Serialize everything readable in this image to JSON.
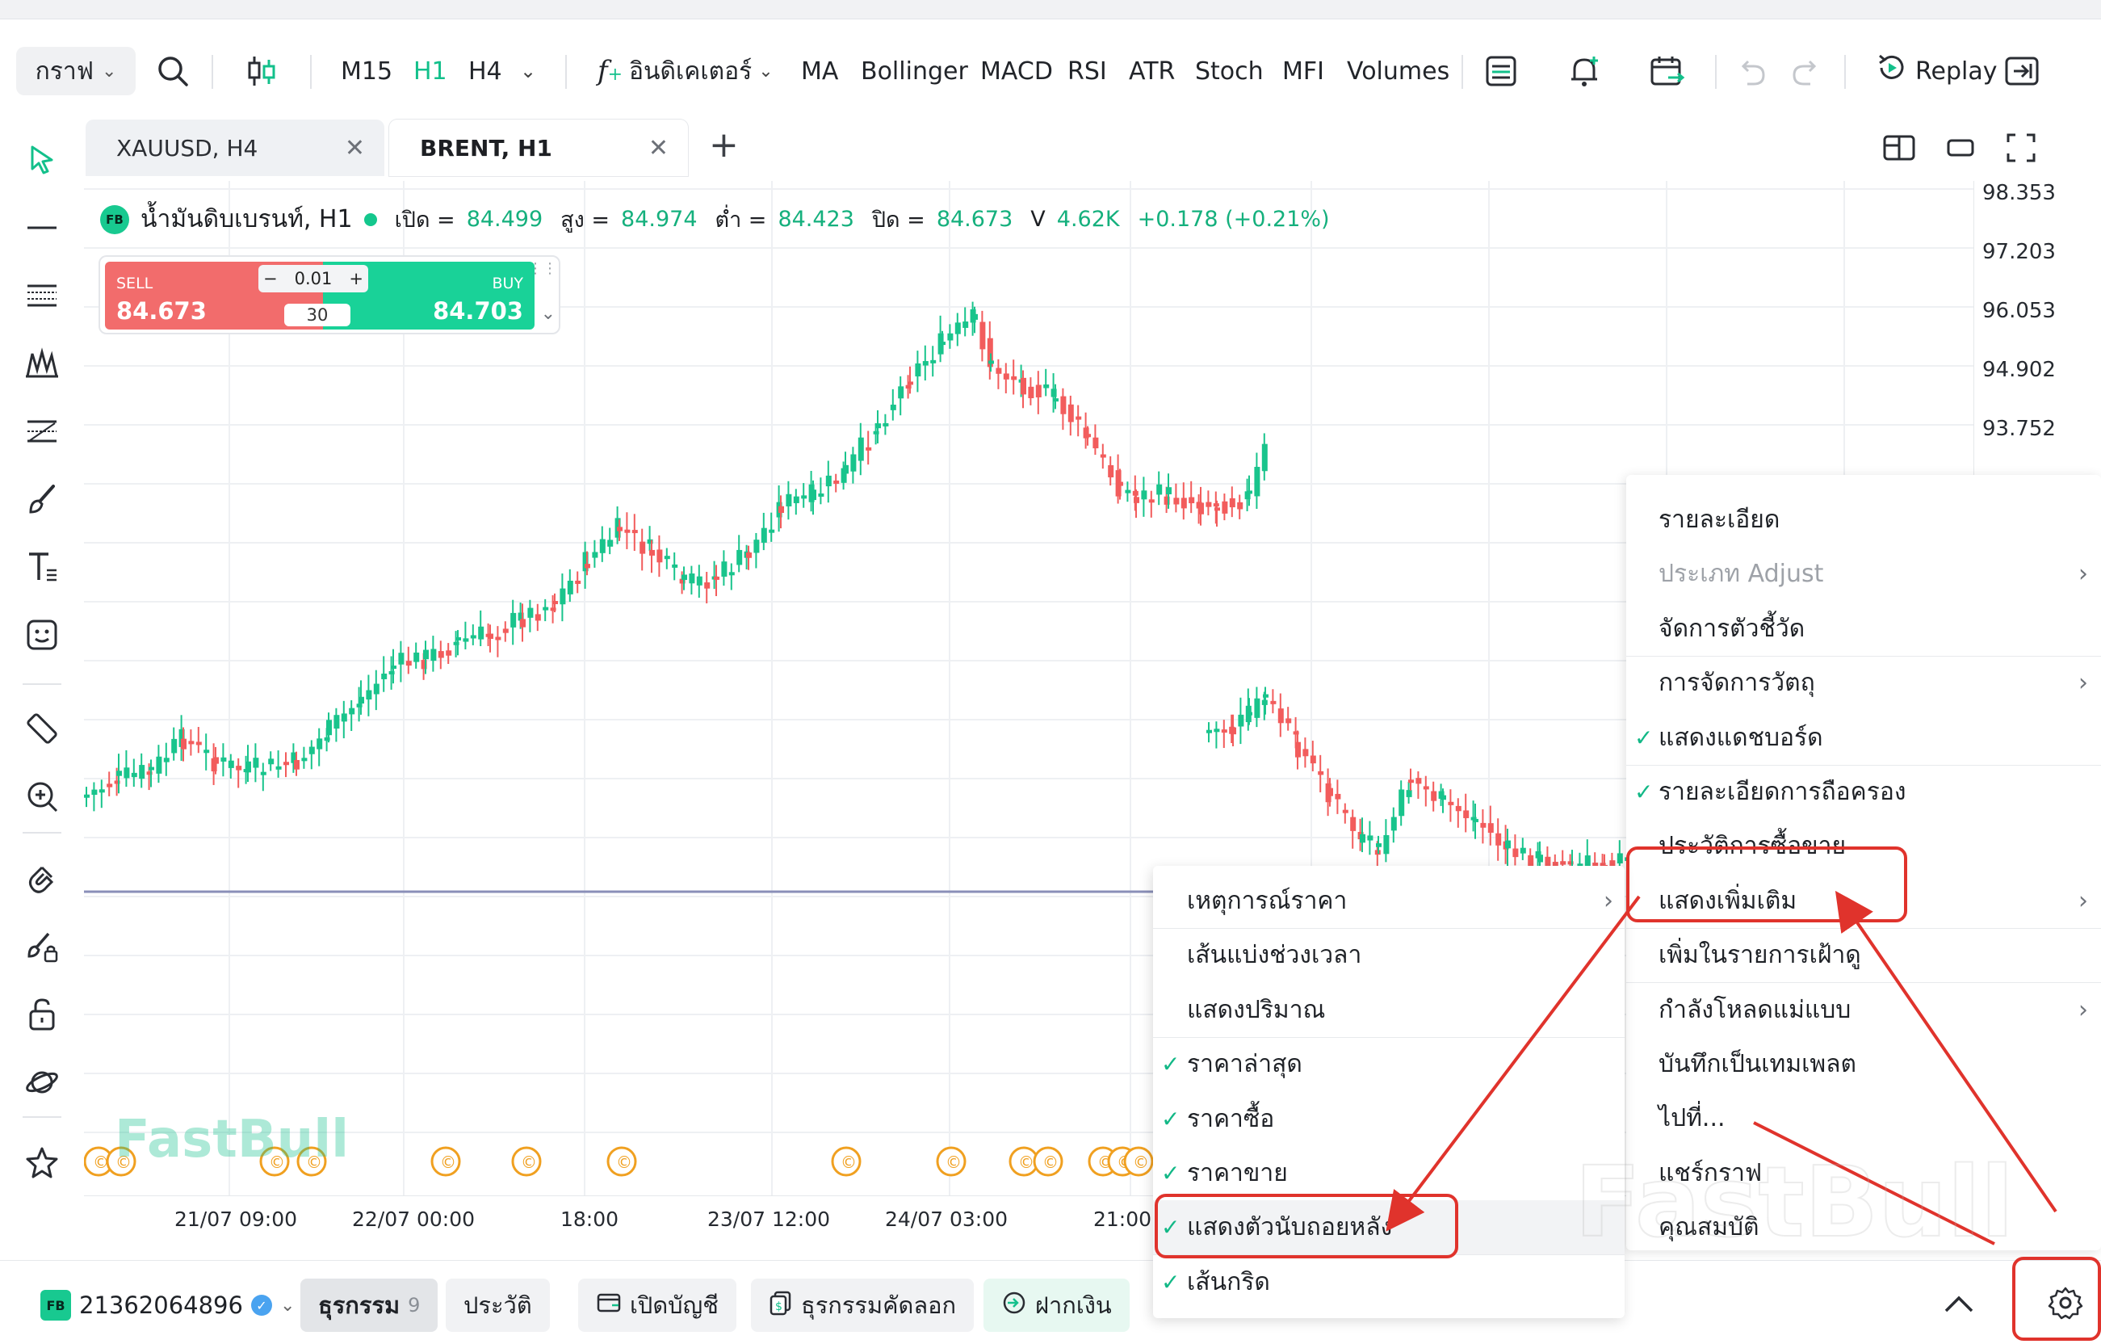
{
  "toolbar": {
    "chart_type": "กราฟ",
    "timeframes": [
      "M15",
      "H1",
      "H4"
    ],
    "active_timeframe": "H1",
    "indicators_label": "อินดิเคเตอร์",
    "indicator_shortcuts": [
      "MA",
      "Bollinger",
      "MACD",
      "RSI",
      "ATR",
      "Stoch",
      "MFI",
      "Volumes"
    ],
    "replay_label": "Replay"
  },
  "tabs": [
    {
      "label": "XAUUSD, H4"
    },
    {
      "label": "BRENT, H1"
    }
  ],
  "legend": {
    "badge": "FB",
    "symbol": "น้ำมันดิบเบรนท์, H1",
    "open_label": "เปิด =",
    "open": "84.499",
    "high_label": "สูง =",
    "high": "84.974",
    "low_label": "ต่ำ =",
    "low": "84.423",
    "close_label": "ปิด =",
    "close": "84.673",
    "volume_label": "V",
    "volume": "4.62K",
    "change": "+0.178 (+0.21%)"
  },
  "trade": {
    "sell_label": "SELL",
    "sell_price": "84.673",
    "buy_label": "BUY",
    "buy_price": "84.703",
    "quantity": "0.01",
    "spread": "30"
  },
  "y_axis_labels": [
    "98.353",
    "97.203",
    "96.053",
    "94.902",
    "93.752"
  ],
  "x_axis_labels": [
    "21/07 09:00",
    "22/07 00:00",
    "18:00",
    "23/07 12:00",
    "24/07 03:00",
    "21:00"
  ],
  "context_menu": {
    "items": [
      {
        "label": "รายละเอียด",
        "checked": false,
        "submenu": false,
        "disabled": false
      },
      {
        "label": "ประเภท Adjust",
        "checked": false,
        "submenu": true,
        "disabled": true
      },
      {
        "label": "จัดการตัวชี้วัด",
        "checked": false,
        "submenu": false,
        "disabled": false
      },
      {
        "label": "การจัดการวัตถุ",
        "checked": false,
        "submenu": true,
        "disabled": false
      },
      {
        "label": "แสดงแดชบอร์ด",
        "checked": true,
        "submenu": false,
        "disabled": false
      },
      {
        "label": "รายละเอียดการถือครอง",
        "checked": true,
        "submenu": false,
        "disabled": false
      },
      {
        "label": "ประวัติการซื้อขาย",
        "checked": false,
        "submenu": false,
        "disabled": false
      },
      {
        "label": "แสดงเพิ่มเติม",
        "checked": false,
        "submenu": true,
        "disabled": false
      },
      {
        "label": "เพิ่มในรายการเฝ้าดู",
        "checked": false,
        "submenu": false,
        "disabled": false
      },
      {
        "label": "กำลังโหลดแม่แบบ",
        "checked": false,
        "submenu": true,
        "disabled": false
      },
      {
        "label": "บันทึกเป็นเทมเพลต",
        "checked": false,
        "submenu": false,
        "disabled": false
      },
      {
        "label": "ไปที่...",
        "checked": false,
        "submenu": false,
        "disabled": false
      },
      {
        "label": "แชร์กราฟ",
        "checked": false,
        "submenu": false,
        "disabled": false
      },
      {
        "label": "คุณสมบัติ",
        "checked": false,
        "submenu": false,
        "disabled": false
      }
    ]
  },
  "submenu": {
    "items": [
      {
        "label": "เหตุการณ์ราคา",
        "checked": false,
        "submenu": true
      },
      {
        "label": "เส้นแบ่งช่วงเวลา",
        "checked": false,
        "submenu": false
      },
      {
        "label": "แสดงปริมาณ",
        "checked": false,
        "submenu": false
      },
      {
        "label": "ราคาล่าสุด",
        "checked": true,
        "submenu": false
      },
      {
        "label": "ราคาซื้อ",
        "checked": true,
        "submenu": false
      },
      {
        "label": "ราคาขาย",
        "checked": true,
        "submenu": false
      },
      {
        "label": "แสดงตัวนับถอยหลัง",
        "checked": true,
        "submenu": false
      },
      {
        "label": "เส้นกริด",
        "checked": true,
        "submenu": false
      }
    ]
  },
  "bottom_bar": {
    "account_badge": "FB",
    "account_id": "21362064896",
    "trades_label": "ธุรกรรม",
    "trades_count": "9",
    "history_label": "ประวัติ",
    "open_account_label": "เปิดบัญชี",
    "copy_trade_label": "ธุรกรรมคัดลอก",
    "deposit_label": "ฝากเงิน"
  },
  "watermark": "FastBull",
  "colors": {
    "up": "#19c48c",
    "down": "#f25c5c",
    "accent": "#13c08b",
    "highlight": "#e0332c"
  },
  "icons": [
    "search-icon",
    "candlestick-icon",
    "indicator-icon",
    "layout-icon",
    "alert-icon",
    "calendar-icon",
    "undo-icon",
    "redo-icon",
    "replay-icon",
    "exit-icon",
    "settings-icon"
  ]
}
